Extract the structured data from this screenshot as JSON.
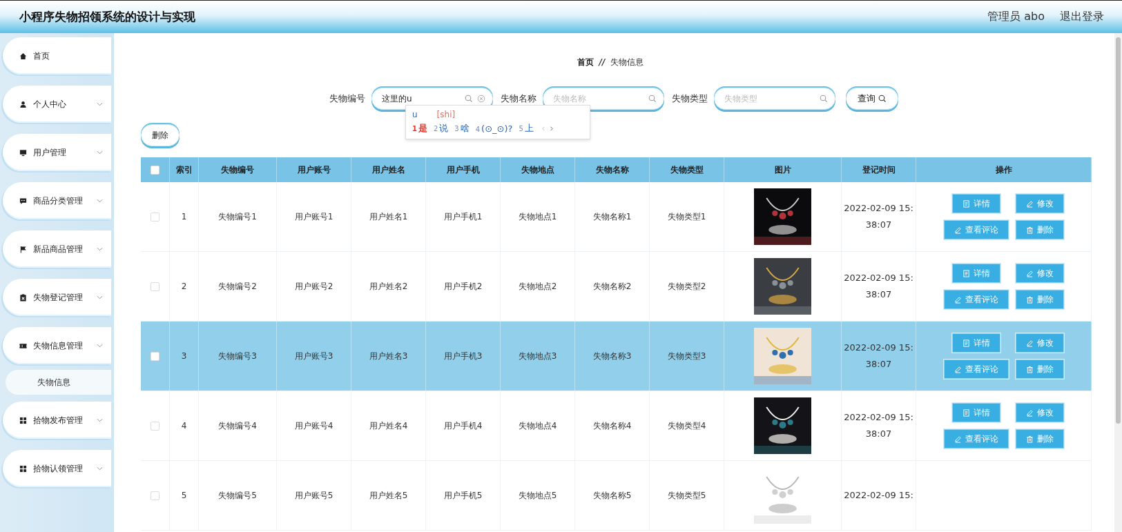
{
  "header": {
    "title": "小程序失物招领系统的设计与实现",
    "user": "管理员 abo",
    "logout": "退出登录"
  },
  "sidebar": {
    "items": [
      {
        "label": "首页",
        "expandable": false
      },
      {
        "label": "个人中心",
        "expandable": true
      },
      {
        "label": "用户管理",
        "expandable": true
      },
      {
        "label": "商品分类管理",
        "expandable": true
      },
      {
        "label": "新品商品管理",
        "expandable": true
      },
      {
        "label": "失物登记管理",
        "expandable": true
      },
      {
        "label": "失物信息管理",
        "expandable": true,
        "children": [
          {
            "label": "失物信息",
            "selected": true
          }
        ]
      },
      {
        "label": "拾物发布管理",
        "expandable": true
      },
      {
        "label": "拾物认领管理",
        "expandable": true
      }
    ]
  },
  "breadcrumb": {
    "home": "首页",
    "separator": "//",
    "current": "失物信息"
  },
  "search": {
    "fields": [
      {
        "label": "失物编号",
        "value": "这里的u",
        "clearable": true
      },
      {
        "label": "失物名称",
        "placeholder": "失物名称",
        "clearable": false
      },
      {
        "label": "失物类型",
        "placeholder": "失物类型",
        "clearable": false
      }
    ],
    "button": "查询"
  },
  "ime": {
    "composition": "u",
    "pinyin": "[shi]",
    "candidates": [
      {
        "num": "1",
        "text": "是",
        "selected": true
      },
      {
        "num": "2",
        "text": "说",
        "selected": false
      },
      {
        "num": "3",
        "text": "啥",
        "selected": false
      },
      {
        "num": "4",
        "text": "(⊙_⊙)?",
        "selected": false
      },
      {
        "num": "5",
        "text": "上",
        "selected": false
      }
    ]
  },
  "delete_button": "删除",
  "table": {
    "columns": [
      "索引",
      "失物编号",
      "用户账号",
      "用户姓名",
      "用户手机",
      "失物地点",
      "失物名称",
      "失物类型",
      "图片",
      "登记时间",
      "操作"
    ],
    "header_checked": false,
    "rows": [
      {
        "selected": false,
        "checked": false,
        "cells": [
          "1",
          "失物编号1",
          "用户账号1",
          "用户姓名1",
          "用户手机1",
          "失物地点1",
          "失物名称1",
          "失物类型1"
        ],
        "picture": {
          "kind": "picture"
        },
        "time": [
          "2022-02-09 15:",
          "38:07"
        ],
        "actions": [
          {
            "kind": "detail",
            "label": "详情"
          },
          {
            "kind": "edit",
            "label": "修改"
          },
          {
            "kind": "comments",
            "label": "查看评论"
          },
          {
            "kind": "delete",
            "label": "删除"
          }
        ]
      },
      {
        "selected": false,
        "checked": false,
        "cells": [
          "2",
          "失物编号2",
          "用户账号2",
          "用户姓名2",
          "用户手机2",
          "失物地点2",
          "失物名称2",
          "失物类型2"
        ],
        "picture": {
          "kind": "picture"
        },
        "time": [
          "2022-02-09 15:",
          "38:07"
        ],
        "actions": [
          {
            "kind": "detail",
            "label": "详情"
          },
          {
            "kind": "edit",
            "label": "修改"
          },
          {
            "kind": "comments",
            "label": "查看评论"
          },
          {
            "kind": "delete",
            "label": "删除"
          }
        ]
      },
      {
        "selected": true,
        "checked": false,
        "cells": [
          "3",
          "失物编号3",
          "用户账号3",
          "用户姓名3",
          "用户手机3",
          "失物地点3",
          "失物名称3",
          "失物类型3"
        ],
        "picture": {
          "kind": "picture"
        },
        "time": [
          "2022-02-09 15:",
          "38:07"
        ],
        "actions": [
          {
            "kind": "detail",
            "label": "详情"
          },
          {
            "kind": "edit",
            "label": "修改"
          },
          {
            "kind": "comments",
            "label": "查看评论"
          },
          {
            "kind": "delete",
            "label": "删除"
          }
        ]
      },
      {
        "selected": false,
        "checked": false,
        "cells": [
          "4",
          "失物编号4",
          "用户账号4",
          "用户姓名4",
          "用户手机4",
          "失物地点4",
          "失物名称4",
          "失物类型4"
        ],
        "picture": {
          "kind": "picture"
        },
        "time": [
          "2022-02-09 15:",
          "38:07"
        ],
        "actions": [
          {
            "kind": "detail",
            "label": "详情"
          },
          {
            "kind": "edit",
            "label": "修改"
          },
          {
            "kind": "comments",
            "label": "查看评论"
          },
          {
            "kind": "delete",
            "label": "删除"
          }
        ]
      },
      {
        "selected": false,
        "checked": false,
        "cells": [
          "5",
          "失物编号5",
          "用户账号5",
          "用户姓名5",
          "用户手机5",
          "失物地点5",
          "失物名称5",
          "失物类型5"
        ],
        "picture": {
          "kind": "picture"
        },
        "time": [
          "2022-02-09 15:"
        ]
      }
    ]
  }
}
